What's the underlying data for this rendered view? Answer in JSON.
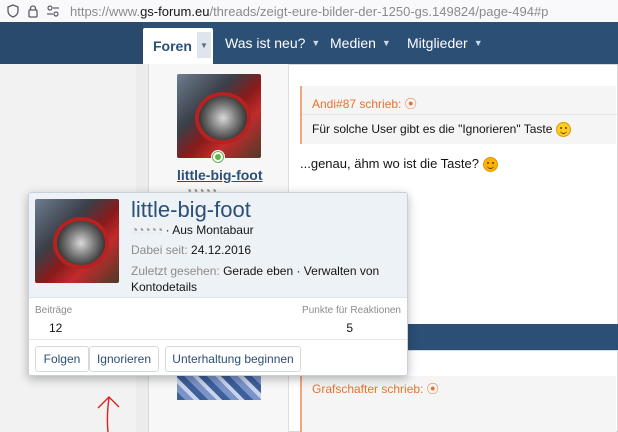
{
  "browser": {
    "url_prefix": "https://www.",
    "url_host": "gs-forum.eu",
    "url_path": "/threads/zeigt-eure-bilder-der-1250-gs.149824/page-494#p",
    "icons": [
      "shield-icon",
      "lock-icon",
      "permissions-icon"
    ]
  },
  "nav": {
    "active": "Foren",
    "items": [
      {
        "label": "Was ist neu?"
      },
      {
        "label": "Medien"
      },
      {
        "label": "Mitglieder"
      }
    ]
  },
  "post": {
    "username": "little-big-foot",
    "rank_glyphs": "◔◔◔◔◔",
    "quote_header": "Andi#87 schrieb:",
    "quote_text": "Für solche User gibt es die \"Ignorieren\" Taste",
    "reply_text": "...genau, ähm wo ist die Taste?"
  },
  "post2": {
    "quote_header": "Grafschafter schrieb:"
  },
  "popup": {
    "name": "little-big-foot",
    "rank_glyphs": "◔◔◔◔◔",
    "location": " · Aus Montabaur",
    "joined_label": "Dabei seit:",
    "joined_value": "24.12.2016",
    "last_seen_label": "Zuletzt gesehen:",
    "last_seen_value": "Gerade eben · Verwalten von Kontodetails",
    "posts_label": "Beiträge",
    "posts_value": "12",
    "reactions_label": "Punkte für Reaktionen",
    "reactions_value": "5",
    "buttons": {
      "follow": "Folgen",
      "ignore": "Ignorieren",
      "conversation": "Unterhaltung beginnen"
    }
  },
  "colors": {
    "nav_bg": "#2c4f75",
    "accent_orange": "#e8732e",
    "online_green": "#63b34a",
    "annotation_red": "#e0201b"
  }
}
